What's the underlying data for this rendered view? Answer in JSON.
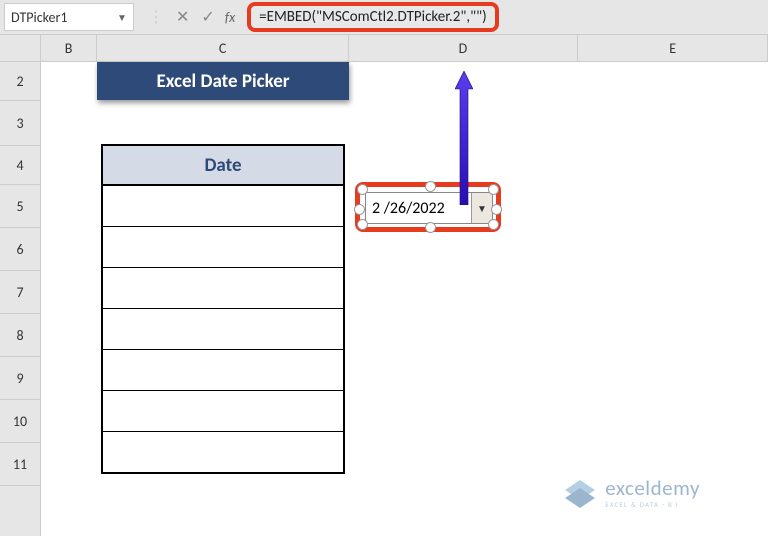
{
  "name_box": {
    "value": "DTPicker1"
  },
  "formula_bar": {
    "fx_label": "fx",
    "formula": "=EMBED(\"MSComCtl2.DTPicker.2\",\"\")"
  },
  "columns": {
    "B": "B",
    "C": "C",
    "D": "D",
    "E": "E"
  },
  "rows": {
    "2": "2",
    "3": "3",
    "4": "4",
    "5": "5",
    "6": "6",
    "7": "7",
    "8": "8",
    "9": "9",
    "10": "10",
    "11": "11"
  },
  "title_banner": "Excel Date Picker",
  "date_table": {
    "header": "Date",
    "rows": [
      "",
      "",
      "",
      "",
      "",
      "",
      ""
    ]
  },
  "dtpicker": {
    "value": "2 /26/2022"
  },
  "watermark": {
    "line1": "exceldemy",
    "line2": "EXCEL & DATA - B I"
  },
  "colors": {
    "highlight": "#e63b1f",
    "banner": "#2e4a78",
    "header_fill": "#d5dbe6",
    "arrow": "#4020d8"
  }
}
